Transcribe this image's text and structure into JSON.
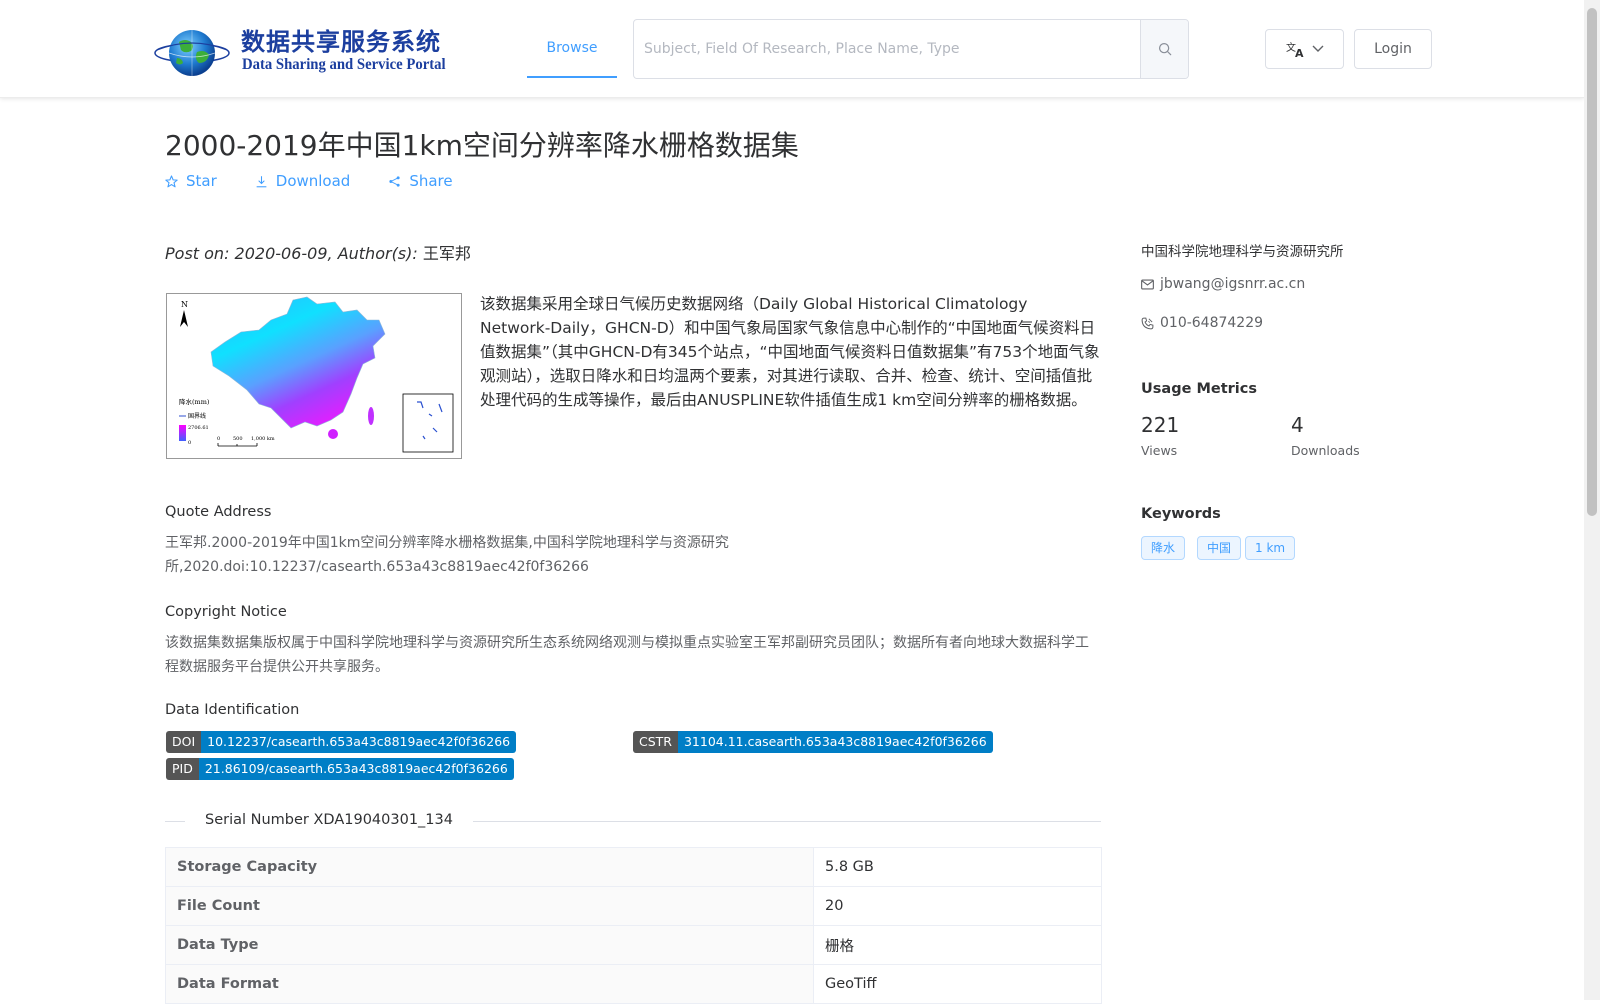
{
  "header": {
    "logo": {
      "cn": "数据共享服务系统",
      "en": "Data Sharing and Service Portal",
      "icon": "globe-logo-icon"
    },
    "nav_browse": "Browse",
    "search_placeholder": "Subject, Field Of Research, Place Name, Type",
    "search_icon": "search-icon",
    "lang_icon": "translate-icon",
    "login": "Login",
    "accent_color": "#409eff"
  },
  "dataset": {
    "title": "2000-2019年中国1km空间分辨率降水栅格数据集",
    "actions": {
      "star": "Star",
      "download": "Download",
      "share": "Share"
    },
    "post_label": "Post on: 2020-06-09, Author(s):",
    "author": "王军邦",
    "abstract": "该数据集采用全球日气候历史数据网络（Daily Global Historical Climatology Network-Daily，GHCN-D）和中国气象局国家气象信息中心制作的“中国地面气候资料日值数据集”（其中GHCN-D有345个站点，“中国地面气候资料日值数据集”有753个地面气象观测站），选取日降水和日均温两个要素，对其进行读取、合并、检查、统计、空间插值批处理代码的生成等操作，最后由ANUSPLINE软件插值生成1 km空间分辨率的栅格数据。",
    "thumbnail": {
      "legend_title": "降水(mm)",
      "legend_line": "国界线",
      "legend_max": "2706.61",
      "legend_min": "0",
      "north": "N",
      "scale_labels": [
        "0",
        "500",
        "1,000 km"
      ]
    },
    "quote_heading": "Quote Address",
    "quote": "王军邦.2000-2019年中国1km空间分辨率降水栅格数据集,中国科学院地理科学与资源研究所,2020.doi:10.12237/casearth.653a43c8819aec42f0f36266",
    "copyright_heading": "Copyright Notice",
    "copyright": "该数据集数据集版权属于中国科学院地理科学与资源研究所生态系统网络观测与模拟重点实验室王军邦副研究员团队；数据所有者向地球大数据科学工程数据服务平台提供公开共享服务。",
    "identification_heading": "Data Identification",
    "identifiers": {
      "doi_key": "DOI",
      "doi": "10.12237/casearth.653a43c8819aec42f0f36266",
      "cstr_key": "CSTR",
      "cstr": "31104.11.casearth.653a43c8819aec42f0f36266",
      "pid_key": "PID",
      "pid": "21.86109/casearth.653a43c8819aec42f0f36266"
    },
    "serial_number": "Serial Number XDA19040301_134",
    "details": [
      {
        "key": "Storage Capacity",
        "value": "5.8 GB"
      },
      {
        "key": "File Count",
        "value": "20"
      },
      {
        "key": "Data Type",
        "value": "栅格"
      },
      {
        "key": "Data Format",
        "value": "GeoTiff"
      }
    ]
  },
  "sidebar": {
    "org": "中国科学院地理科学与资源研究所",
    "email": "jbwang@igsnrr.ac.cn",
    "phone": "010-64874229",
    "usage_heading": "Usage Metrics",
    "views": "221",
    "views_label": "Views",
    "downloads": "4",
    "downloads_label": "Downloads",
    "keywords_heading": "Keywords",
    "keywords": [
      "降水",
      "中国",
      "1 km"
    ]
  }
}
